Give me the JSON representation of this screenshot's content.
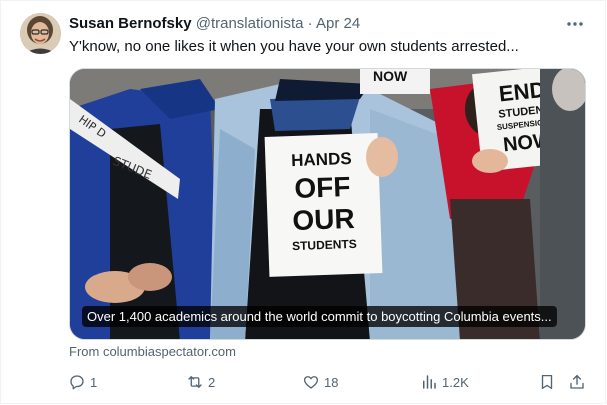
{
  "tweet": {
    "author_name": "Susan Bernofsky",
    "author_handle": "@translationista",
    "separator": "·",
    "date": "Apr 24",
    "text": "Y'know, no one likes it when you have your own students arrested...",
    "more_icon": "more-horizontal-icon"
  },
  "card": {
    "caption": "Over 1,400 academics around the world commit to boycotting Columbia events...",
    "sign_center_lines": [
      "HANDS",
      "OFF",
      "OUR",
      "STUDENTS"
    ],
    "sign_right_lines": [
      "END",
      "STUDENT",
      "SUSPENSIONS",
      "NOW"
    ],
    "sign_top_text": "NOW",
    "sign_left_text": "STUDE",
    "sign_left_partial": "HIP D"
  },
  "source": {
    "text": "From columbiaspectator.com"
  },
  "actions": {
    "reply": {
      "icon": "reply-icon",
      "count": "1"
    },
    "repost": {
      "icon": "repost-icon",
      "count": "2"
    },
    "like": {
      "icon": "like-icon",
      "count": "18"
    },
    "views": {
      "icon": "views-icon",
      "count": "1.2K"
    },
    "bookmark": {
      "icon": "bookmark-icon"
    },
    "share": {
      "icon": "share-icon"
    }
  },
  "colors": {
    "text_primary": "#0f1419",
    "text_secondary": "#536471",
    "border": "#cfd9de"
  }
}
